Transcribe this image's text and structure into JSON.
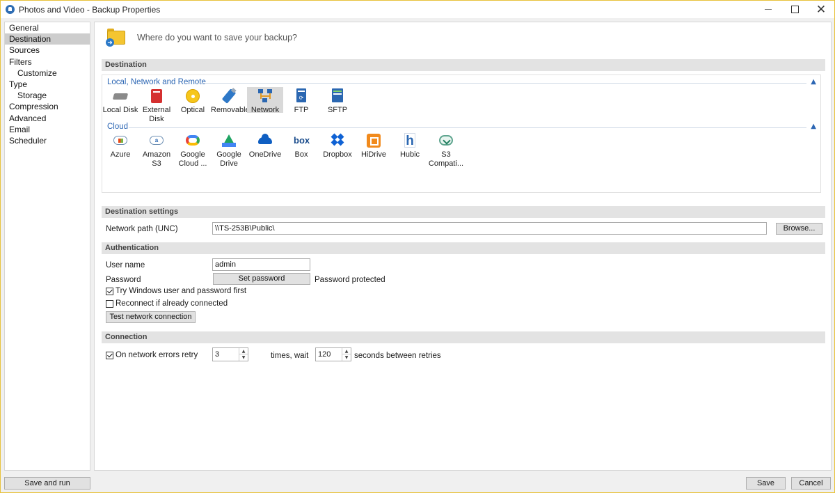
{
  "window": {
    "title": "Photos and Video - Backup Properties"
  },
  "sidebar": {
    "items": [
      {
        "label": "General"
      },
      {
        "label": "Destination"
      },
      {
        "label": "Sources"
      },
      {
        "label": "Filters"
      },
      {
        "label": "Customize"
      },
      {
        "label": "Type"
      },
      {
        "label": "Storage"
      },
      {
        "label": "Compression"
      },
      {
        "label": "Advanced"
      },
      {
        "label": "Email"
      },
      {
        "label": "Scheduler"
      }
    ],
    "selected": "Destination"
  },
  "header": {
    "question": "Where do you want to save your backup?"
  },
  "destination": {
    "section_title": "Destination",
    "local_group": {
      "title": "Local, Network and Remote",
      "items": [
        {
          "label": "Local Disk",
          "icon": "hard-disk-icon"
        },
        {
          "label": "External Disk",
          "icon": "external-disk-icon"
        },
        {
          "label": "Optical",
          "icon": "optical-disc-icon"
        },
        {
          "label": "Removable",
          "icon": "usb-drive-icon"
        },
        {
          "label": "Network",
          "icon": "network-icon"
        },
        {
          "label": "FTP",
          "icon": "ftp-icon"
        },
        {
          "label": "SFTP",
          "icon": "sftp-icon"
        }
      ],
      "selected": "Network"
    },
    "cloud_group": {
      "title": "Cloud",
      "items": [
        {
          "label": "Azure",
          "icon": "azure-icon"
        },
        {
          "label": "Amazon S3",
          "icon": "amazon-s3-icon"
        },
        {
          "label": "Google Cloud ...",
          "icon": "google-cloud-icon"
        },
        {
          "label": "Google Drive",
          "icon": "google-drive-icon"
        },
        {
          "label": "OneDrive",
          "icon": "onedrive-icon"
        },
        {
          "label": "Box",
          "icon": "box-icon"
        },
        {
          "label": "Dropbox",
          "icon": "dropbox-icon"
        },
        {
          "label": "HiDrive",
          "icon": "hidrive-icon"
        },
        {
          "label": "Hubic",
          "icon": "hubic-icon"
        },
        {
          "label": "S3 Compati...",
          "icon": "s3-compatible-icon"
        }
      ]
    }
  },
  "destination_settings": {
    "section_title": "Destination settings",
    "network_path_label": "Network path (UNC)",
    "network_path_value": "\\\\TS-253B\\Public\\",
    "browse_label": "Browse..."
  },
  "authentication": {
    "section_title": "Authentication",
    "user_name_label": "User name",
    "user_name_value": "admin",
    "password_label": "Password",
    "set_password_label": "Set password",
    "password_status": "Password protected",
    "try_windows_label": "Try Windows user and password first",
    "try_windows_checked": true,
    "reconnect_label": "Reconnect if already connected",
    "reconnect_checked": false,
    "test_connection_label": "Test network connection"
  },
  "connection": {
    "section_title": "Connection",
    "retry_label": "On network errors retry",
    "retry_checked": true,
    "retry_count": "3",
    "times_wait_label": "times, wait",
    "wait_seconds": "120",
    "seconds_label": "seconds between retries"
  },
  "footer": {
    "save_and_run_label": "Save and run",
    "save_label": "Save",
    "cancel_label": "Cancel"
  },
  "colors": {
    "accent": "#2d67b4",
    "window_border": "#e8c23a",
    "selection": "#cdcdcd"
  }
}
